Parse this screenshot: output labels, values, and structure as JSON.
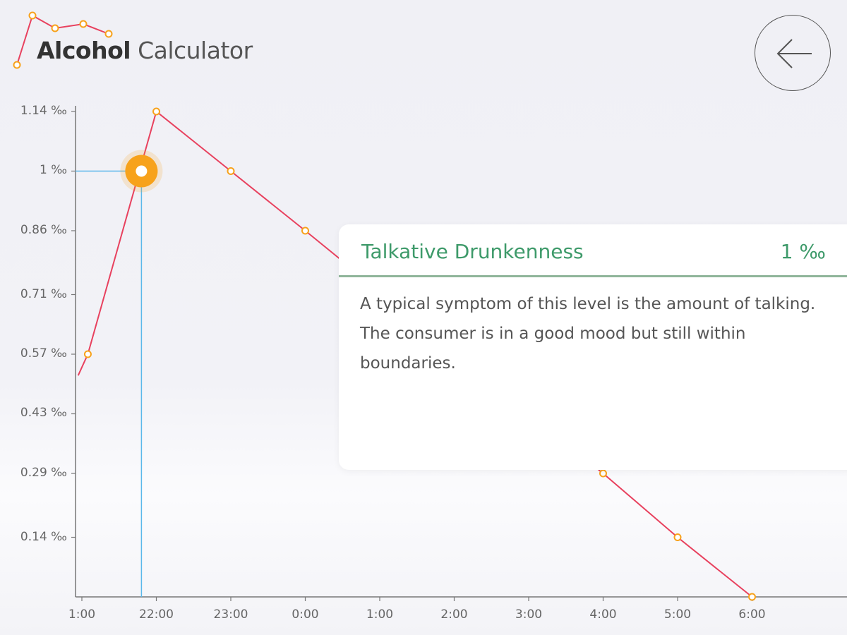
{
  "header": {
    "title_bold": "Alcohol",
    "title_light": "Calculator"
  },
  "colors": {
    "line": "#e8415e",
    "marker": "#f7a21b",
    "selection": "#5ab8ea",
    "card_accent": "#3e9a6a",
    "axis": "#777777"
  },
  "icons": {
    "logo": "mini-line-chart-icon",
    "back": "arrow-left-icon"
  },
  "chart_data": {
    "type": "line",
    "x_ticks": [
      "1:00",
      "22:00",
      "23:00",
      "0:00",
      "1:00",
      "2:00",
      "3:00",
      "4:00",
      "5:00",
      "6:00"
    ],
    "y_ticks": [
      "1.14 ‰",
      "1 ‰",
      "0.86 ‰",
      "0.71 ‰",
      "0.57 ‰",
      "0.43 ‰",
      "0.29 ‰",
      "0.14 ‰"
    ],
    "ylim": [
      0,
      1.14
    ],
    "y_unit": "‰",
    "grid": false,
    "series": [
      {
        "x": [
          0.08,
          1.0,
          2.0,
          3.0,
          7.0,
          8.0,
          9.0
        ],
        "y": [
          0.57,
          1.14,
          1.0,
          0.86,
          0.29,
          0.14,
          0.0
        ]
      }
    ],
    "series_start": {
      "x": -0.05,
      "y": 0.52
    },
    "selected_point": {
      "x": 0.8,
      "y": 1.0
    }
  },
  "card": {
    "title": "Talkative Drunkenness",
    "value": "1 ‰",
    "description": "A typical symptom of this level is the amount of talking. The consumer is in a good mood but still within boundaries."
  }
}
